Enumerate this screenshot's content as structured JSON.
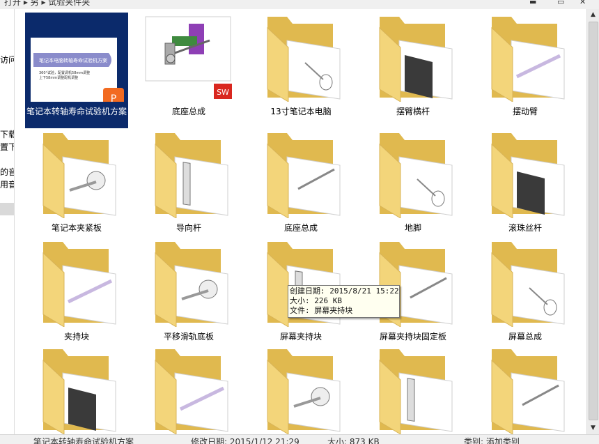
{
  "topbar": {
    "breadcrumb": "打开 ▸ 另 ▸ 试验夹件夹",
    "min": "▬",
    "max": "▭",
    "close": "✕"
  },
  "nav": {
    "items": [
      "访问",
      "下载",
      "置下",
      "的音",
      "用音"
    ]
  },
  "files": [
    {
      "name": "笔记本转轴寿命试验机方案",
      "kind": "pptx",
      "selected": true,
      "preview_title": "笔记本电脑转轴寿命试验机方案",
      "preview_line1": "360°试验，配置调机58mm调整",
      "preview_line2": "上下58mm调整配机调整"
    },
    {
      "name": "底座总成",
      "kind": "sw-assembly"
    },
    {
      "name": "13寸笔记本电脑",
      "kind": "folder"
    },
    {
      "name": "摆臂横杆",
      "kind": "folder"
    },
    {
      "name": "摆动臂",
      "kind": "folder"
    },
    {
      "name": "笔记本夹紧板",
      "kind": "folder"
    },
    {
      "name": "导向杆",
      "kind": "folder"
    },
    {
      "name": "底座总成",
      "kind": "folder"
    },
    {
      "name": "地脚",
      "kind": "folder"
    },
    {
      "name": "滚珠丝杆",
      "kind": "folder"
    },
    {
      "name": "夹持块",
      "kind": "folder"
    },
    {
      "name": "平移滑轨底板",
      "kind": "folder"
    },
    {
      "name": "屏幕夹持块",
      "kind": "folder"
    },
    {
      "name": "屏幕夹持块固定板",
      "kind": "folder"
    },
    {
      "name": "屏幕总成",
      "kind": "folder"
    },
    {
      "name": "",
      "kind": "folder"
    },
    {
      "name": "",
      "kind": "folder"
    },
    {
      "name": "",
      "kind": "folder"
    },
    {
      "name": "",
      "kind": "folder"
    },
    {
      "name": "",
      "kind": "folder"
    }
  ],
  "tooltip": {
    "created": "创建日期: 2015/8/21 15:22",
    "size": "大小: 226 KB",
    "file": "文件: 屏幕夹持块"
  },
  "status": {
    "name": "笔记本转轴寿命试验机方案",
    "modified": "修改日期: 2015/1/12 21:29",
    "size": "大小: 873 KB",
    "category": "类别: 添加类别"
  },
  "colors": {
    "selection": "#0b2a6b",
    "folder": "#f3d57a",
    "folder_dark": "#e0b94f",
    "sw_badge": "#d9271f",
    "ppt_badge": "#f26b21"
  }
}
